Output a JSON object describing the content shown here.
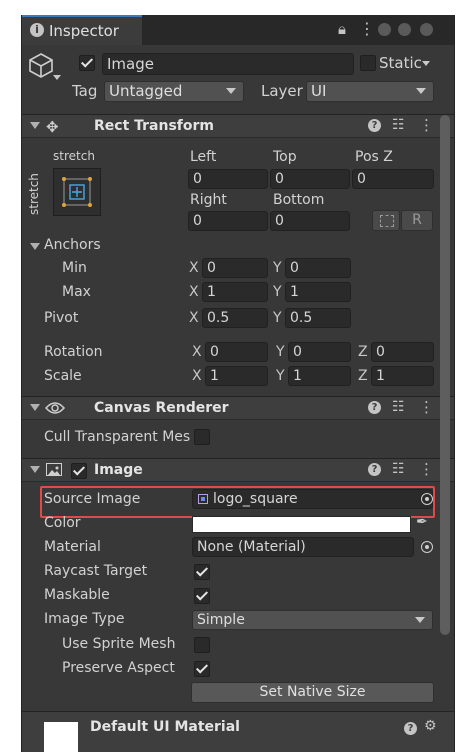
{
  "tab": {
    "title": "Inspector"
  },
  "object": {
    "name": "Image",
    "active": true,
    "static_label": "Static",
    "static": false,
    "tag_label": "Tag",
    "tag": "Untagged",
    "layer_label": "Layer",
    "layer": "UI"
  },
  "rect_transform": {
    "title": "Rect Transform",
    "anchor_preset_top": "stretch",
    "anchor_preset_side": "stretch",
    "labels": {
      "left": "Left",
      "top": "Top",
      "posz": "Pos Z",
      "right": "Right",
      "bottom": "Bottom"
    },
    "values": {
      "left": "0",
      "top": "0",
      "posz": "0",
      "right": "0",
      "bottom": "0"
    },
    "raw_button": "R",
    "anchors_label": "Anchors",
    "min_label": "Min",
    "min_x": "0",
    "min_y": "0",
    "max_label": "Max",
    "max_x": "1",
    "max_y": "1",
    "pivot_label": "Pivot",
    "pivot_x": "0.5",
    "pivot_y": "0.5",
    "rotation_label": "Rotation",
    "rot_x": "0",
    "rot_y": "0",
    "rot_z": "0",
    "scale_label": "Scale",
    "scale_x": "1",
    "scale_y": "1",
    "scale_z": "1",
    "axis_x": "X",
    "axis_y": "Y",
    "axis_z": "Z"
  },
  "canvas_renderer": {
    "title": "Canvas Renderer",
    "cull_label": "Cull Transparent Mes",
    "cull": false
  },
  "image": {
    "title": "Image",
    "enabled": true,
    "source_label": "Source Image",
    "source_value": "logo_square",
    "color_label": "Color",
    "color": "#ffffff",
    "material_label": "Material",
    "material_value": "None (Material)",
    "raycast_label": "Raycast Target",
    "raycast": true,
    "maskable_label": "Maskable",
    "maskable": true,
    "image_type_label": "Image Type",
    "image_type": "Simple",
    "sprite_mesh_label": "Use Sprite Mesh",
    "sprite_mesh": false,
    "preserve_label": "Preserve Aspect",
    "preserve": true,
    "native_size_button": "Set Native Size"
  },
  "material_footer": {
    "name": "Default UI Material"
  },
  "colors": {
    "panel": "#383838",
    "header": "#3e3e3e",
    "highlight": "#e04a4a",
    "accent": "#3a79bb"
  }
}
